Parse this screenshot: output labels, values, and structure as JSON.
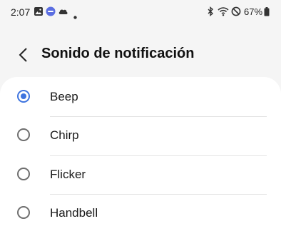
{
  "status_bar": {
    "time": "2:07",
    "battery": "67%",
    "icons": [
      "gallery-icon",
      "app-notification-icon",
      "cloud-icon",
      "dot-icon",
      "bluetooth-icon",
      "wifi-icon",
      "do-not-disturb-icon",
      "battery-icon"
    ]
  },
  "header": {
    "title": "Sonido de notificación",
    "back_icon": "back-chevron-icon"
  },
  "options": [
    {
      "label": "Beep",
      "selected": true
    },
    {
      "label": "Chirp",
      "selected": false
    },
    {
      "label": "Flicker",
      "selected": false
    },
    {
      "label": "Handbell",
      "selected": false
    }
  ],
  "colors": {
    "accent": "#3e74df",
    "background": "#f5f5f5",
    "card": "#ffffff"
  }
}
